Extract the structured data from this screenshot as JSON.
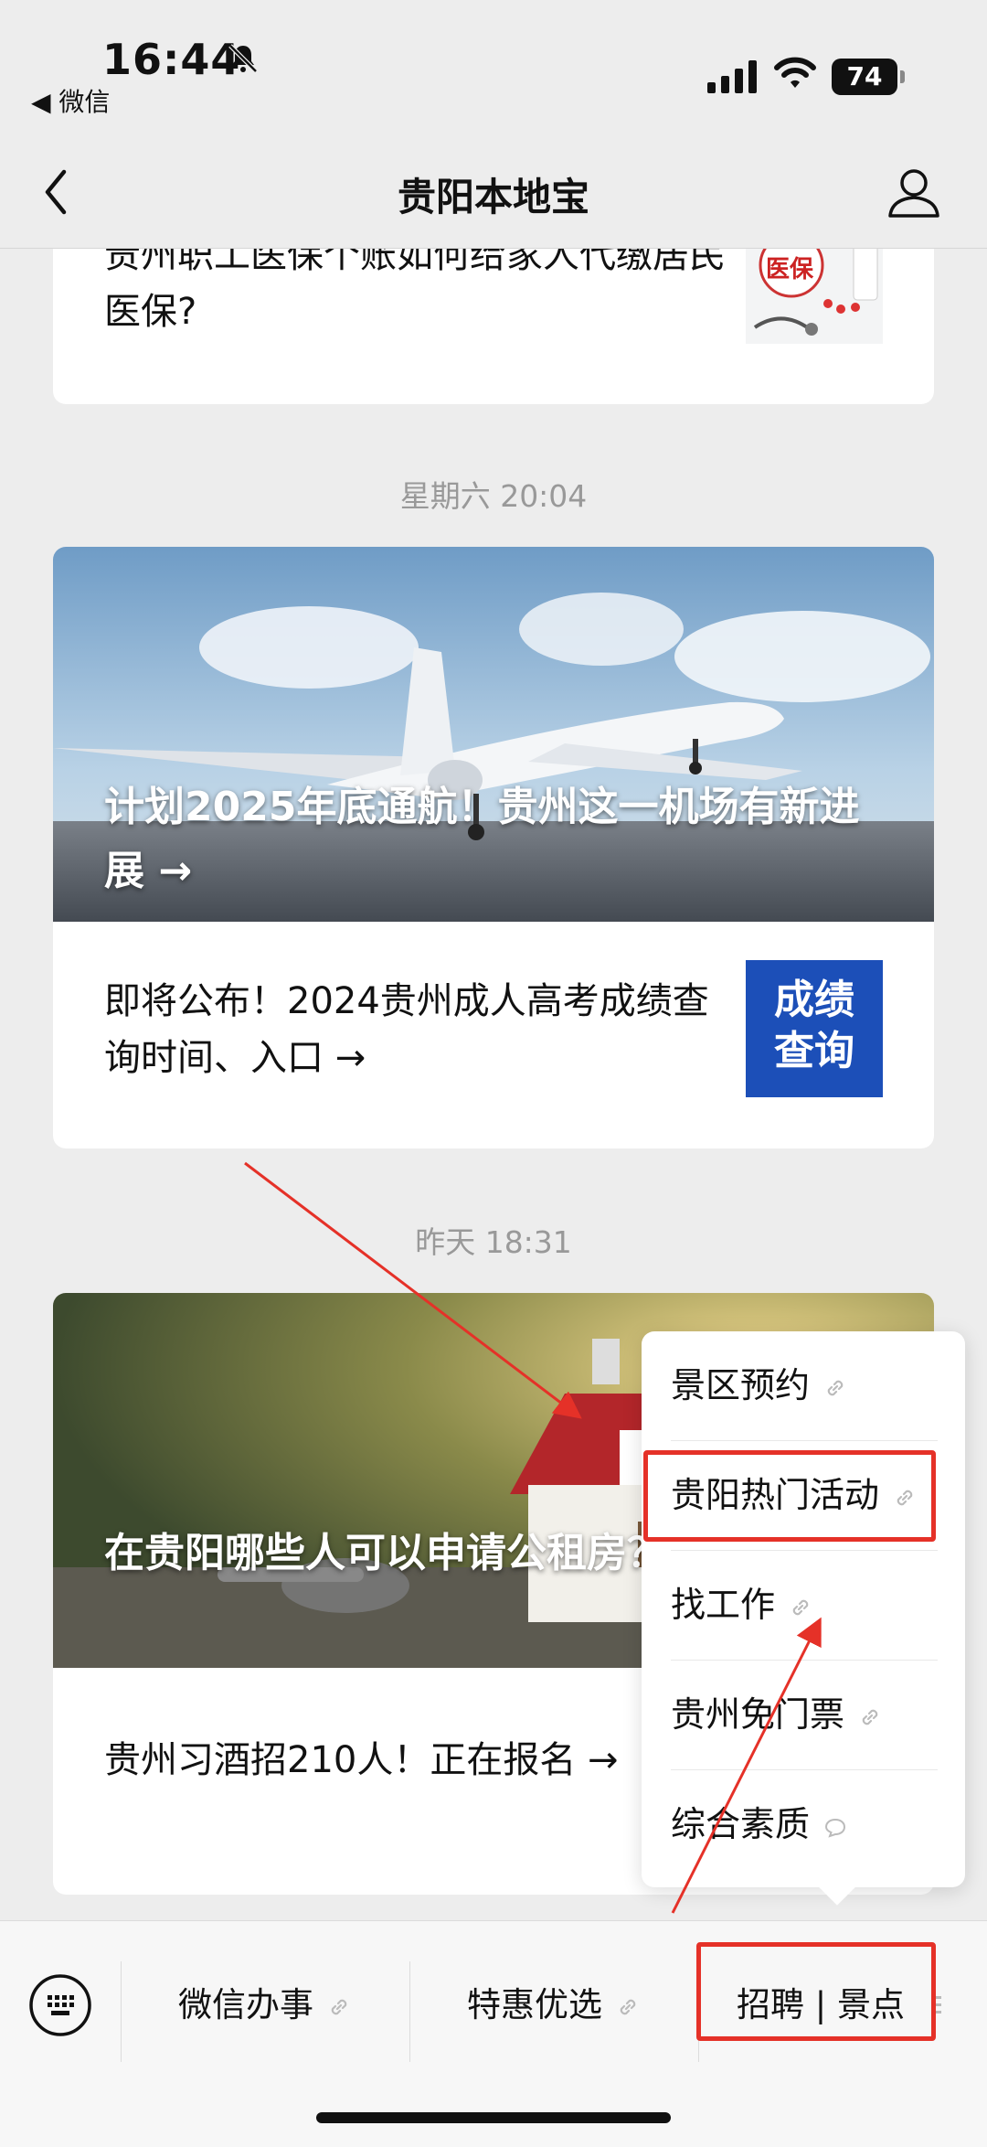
{
  "status_bar": {
    "time": "16:44",
    "back_app": "◀ 微信",
    "battery": "74"
  },
  "nav": {
    "title": "贵阳本地宝"
  },
  "feed": {
    "item1": {
      "title": "贵州职工医保个账如何给家人代缴居民医保?",
      "thumb_label": "医保"
    },
    "ts1": "星期六 20:04",
    "cover1": {
      "title": "计划2025年底通航！贵州这一机场有新进展 →"
    },
    "item2": {
      "title": "即将公布！2024贵州成人高考成绩查询时间、入口 →",
      "thumb_label": "成绩查询"
    },
    "ts2": "昨天 18:31",
    "cover2": {
      "title": "在贵阳哪些人可以申请公租房？如何申请?"
    },
    "item3": {
      "title": "贵州习酒招210人！正在报名 →"
    }
  },
  "popup_menu": {
    "items": [
      {
        "label": "景区预约",
        "icon": "link-icon"
      },
      {
        "label": "贵阳热门活动",
        "icon": "link-icon"
      },
      {
        "label": "找工作",
        "icon": "link-icon"
      },
      {
        "label": "贵州免门票",
        "icon": "link-icon"
      },
      {
        "label": "综合素质",
        "icon": "chat-icon"
      }
    ]
  },
  "bottom_menu": {
    "items": [
      {
        "label": "微信办事",
        "icon": "link-icon"
      },
      {
        "label": "特惠优选",
        "icon": "link-icon"
      },
      {
        "label": "招聘 | 景点"
      }
    ]
  },
  "colors": {
    "annotation_red": "#e53128",
    "background": "#ededed"
  }
}
